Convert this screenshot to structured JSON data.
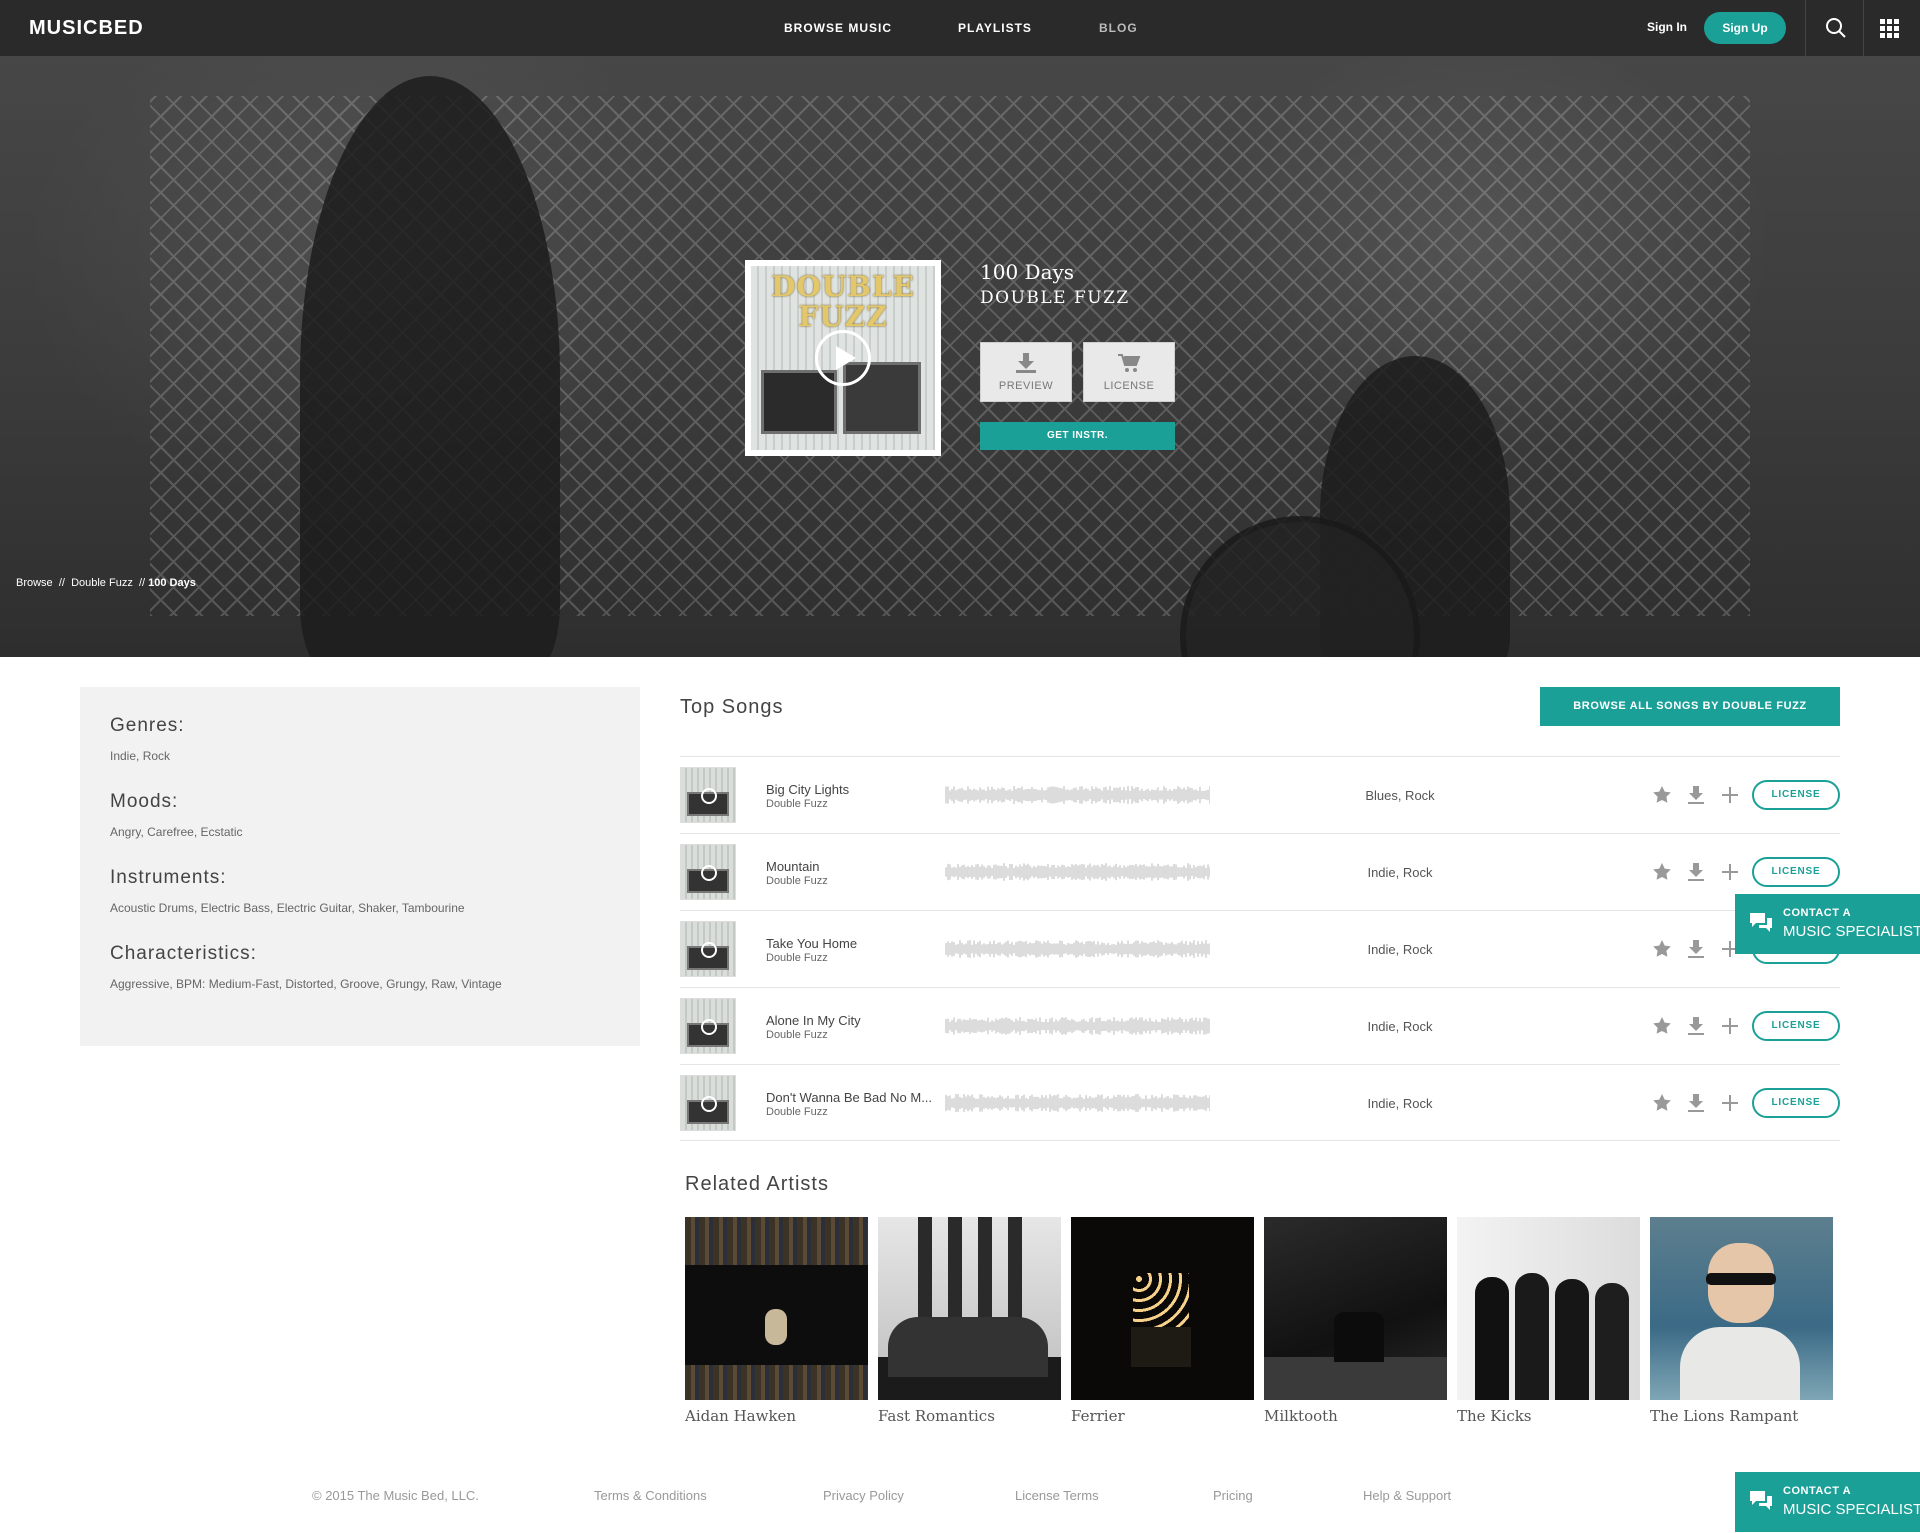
{
  "nav": {
    "logo": "MUSICBED",
    "links": [
      "BROWSE MUSIC",
      "PLAYLISTS",
      "BLOG"
    ],
    "sign_in": "Sign In",
    "sign_up": "Sign Up",
    "icons": [
      "search-icon",
      "apps-grid-icon"
    ]
  },
  "hero": {
    "album_art_text": [
      "DOUBLE",
      "FUZZ"
    ],
    "song_title": "100 Days",
    "artist": "DOUBLE FUZZ",
    "preview_label": "PREVIEW",
    "license_label": "LICENSE",
    "get_instr_label": "GET INSTR.",
    "breadcrumb": {
      "browse": "Browse",
      "sep": "//",
      "artist": "Double Fuzz",
      "song": "100 Days"
    }
  },
  "info": {
    "genres_label": "Genres:",
    "genres": "Indie, Rock",
    "moods_label": "Moods:",
    "moods": "Angry, Carefree, Ecstatic",
    "instruments_label": "Instruments:",
    "instruments": "Acoustic Drums, Electric Bass, Electric Guitar, Shaker, Tambourine",
    "characteristics_label": "Characteristics:",
    "characteristics": "Aggressive, BPM: Medium-Fast, Distorted, Groove, Grungy, Raw, Vintage"
  },
  "top_songs": {
    "title": "Top Songs",
    "browse_all": "BROWSE ALL SONGS BY DOUBLE FUZZ",
    "license_label": "LICENSE",
    "rows": [
      {
        "name": "Big City Lights",
        "artist": "Double Fuzz",
        "genres": "Blues, Rock"
      },
      {
        "name": "Mountain",
        "artist": "Double Fuzz",
        "genres": "Indie, Rock"
      },
      {
        "name": "Take You Home",
        "artist": "Double Fuzz",
        "genres": "Indie, Rock"
      },
      {
        "name": "Alone In My City",
        "artist": "Double Fuzz",
        "genres": "Indie, Rock"
      },
      {
        "name": "Don't Wanna Be Bad No M...",
        "artist": "Double Fuzz",
        "genres": "Indie, Rock"
      }
    ]
  },
  "related": {
    "title": "Related Artists",
    "artists": [
      "Aidan Hawken",
      "Fast Romantics",
      "Ferrier",
      "Milktooth",
      "The Kicks",
      "The Lions Rampant"
    ]
  },
  "contact": {
    "line1": "CONTACT A",
    "line2": "MUSIC SPECIALIST"
  },
  "footer": {
    "copyright": "© 2015 The Music Bed, LLC.",
    "links": [
      "Terms & Conditions",
      "Privacy Policy",
      "License Terms",
      "Pricing",
      "Help & Support"
    ]
  },
  "colors": {
    "accent": "#1ba097",
    "nav_bg": "#2a2a2a",
    "panel_bg": "#f2f2f2"
  }
}
